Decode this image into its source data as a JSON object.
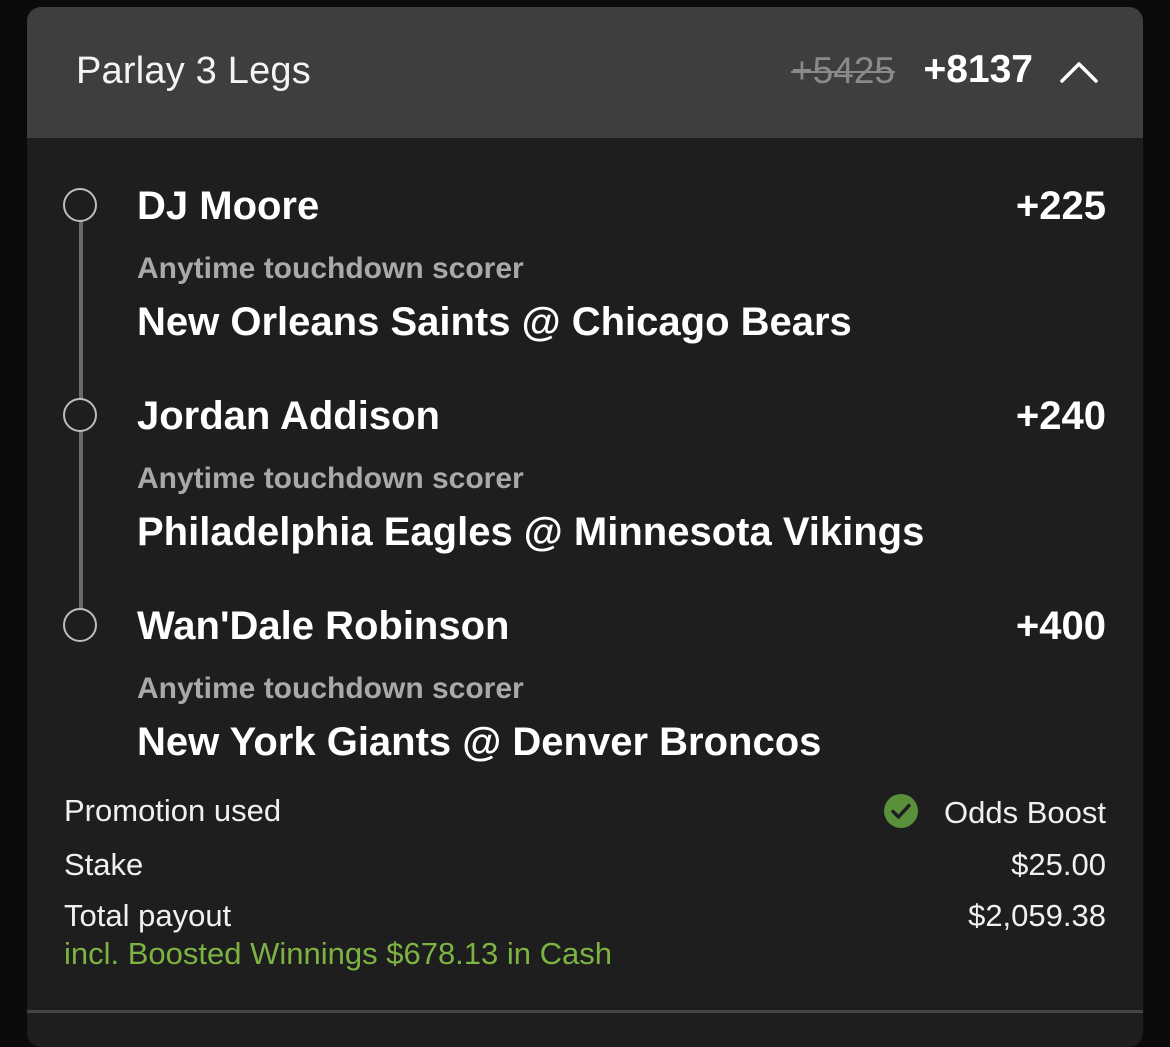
{
  "header": {
    "title": "Parlay 3 Legs",
    "original_odds": "+5425",
    "boosted_odds": "+8137",
    "collapse_icon": "chevron-up-icon"
  },
  "legs": [
    {
      "player": "DJ Moore",
      "odds": "+225",
      "market": "Anytime touchdown scorer",
      "game": "New Orleans Saints @ Chicago Bears"
    },
    {
      "player": "Jordan Addison",
      "odds": "+240",
      "market": "Anytime touchdown scorer",
      "game": "Philadelphia Eagles @ Minnesota Vikings"
    },
    {
      "player": "Wan'Dale Robinson",
      "odds": "+400",
      "market": "Anytime touchdown scorer",
      "game": "New York Giants @ Denver Broncos"
    }
  ],
  "summary": {
    "promotion_label": "Promotion used",
    "promotion_value": "Odds Boost",
    "promotion_icon": "check-circle-icon",
    "stake_label": "Stake",
    "stake_value": "$25.00",
    "payout_label": "Total payout",
    "payout_value": "$2,059.38",
    "boost_note": "incl. Boosted Winnings $678.13 in Cash"
  },
  "colors": {
    "header_bg": "#3e3e3e",
    "card_bg": "#1e1e1e",
    "accent_green": "#7cb342",
    "muted_text": "#a9a9a9"
  }
}
